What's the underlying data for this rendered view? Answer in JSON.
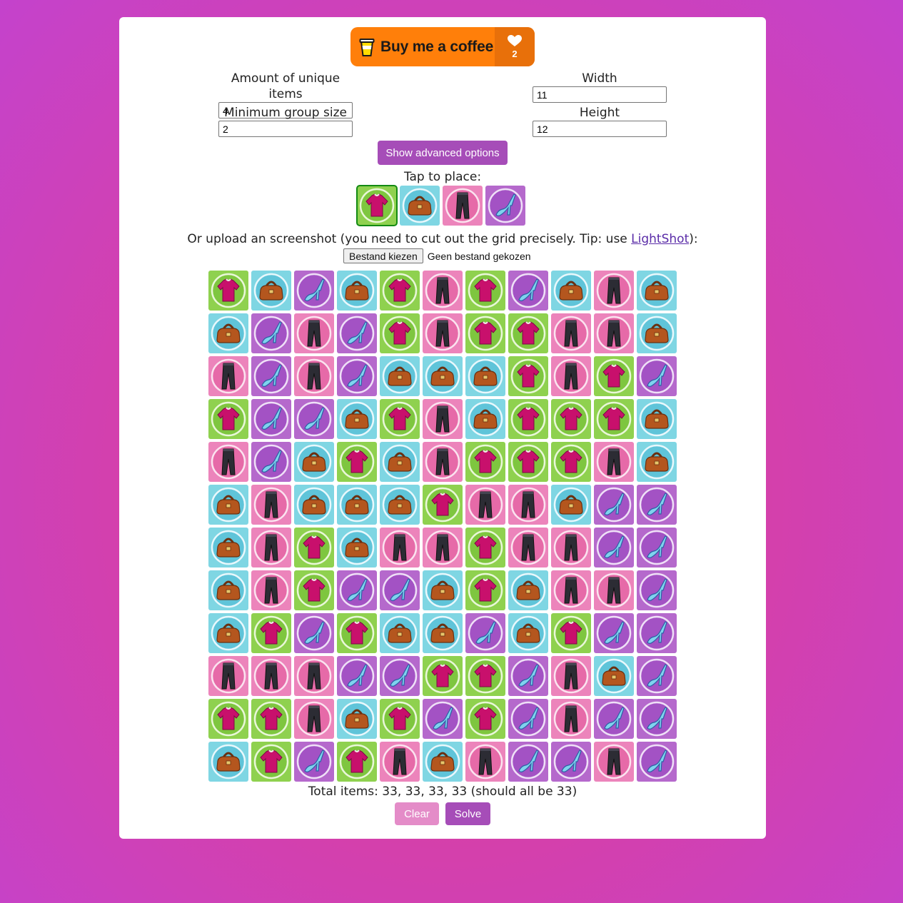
{
  "coffee": {
    "label": "Buy me a coffee",
    "count": "2"
  },
  "fields": {
    "unique_items": {
      "label": "Amount of unique items",
      "value": "4"
    },
    "width": {
      "label": "Width",
      "value": "11"
    },
    "min_group": {
      "label": "Minimum group size",
      "value": "2"
    },
    "height": {
      "label": "Height",
      "value": "12"
    }
  },
  "advanced_button": "Show advanced options",
  "tap_label": "Tap to place:",
  "palette": [
    "shirt",
    "bag",
    "pants",
    "heel"
  ],
  "palette_selected": "shirt",
  "upload": {
    "text_before": "Or upload an screenshot (you need to cut out the grid precisely. Tip: use ",
    "link": "LightShot",
    "text_after": "):",
    "file_button": "Bestand kiezen",
    "file_status": "Geen bestand gekozen"
  },
  "grid": [
    [
      "shirt",
      "bag",
      "heel",
      "bag",
      "shirt",
      "pants",
      "shirt",
      "heel",
      "bag",
      "pants",
      "bag"
    ],
    [
      "bag",
      "heel",
      "pants",
      "heel",
      "shirt",
      "pants",
      "shirt",
      "shirt",
      "pants",
      "pants",
      "bag"
    ],
    [
      "pants",
      "heel",
      "pants",
      "heel",
      "bag",
      "bag",
      "bag",
      "shirt",
      "pants",
      "shirt",
      "heel"
    ],
    [
      "shirt",
      "heel",
      "heel",
      "bag",
      "shirt",
      "pants",
      "bag",
      "shirt",
      "shirt",
      "shirt",
      "bag"
    ],
    [
      "pants",
      "heel",
      "bag",
      "shirt",
      "bag",
      "pants",
      "shirt",
      "shirt",
      "shirt",
      "pants",
      "bag"
    ],
    [
      "bag",
      "pants",
      "bag",
      "bag",
      "bag",
      "shirt",
      "pants",
      "pants",
      "bag",
      "heel",
      "heel"
    ],
    [
      "bag",
      "pants",
      "shirt",
      "bag",
      "pants",
      "pants",
      "shirt",
      "pants",
      "pants",
      "heel",
      "heel"
    ],
    [
      "bag",
      "pants",
      "shirt",
      "heel",
      "heel",
      "bag",
      "shirt",
      "bag",
      "pants",
      "pants",
      "heel"
    ],
    [
      "bag",
      "shirt",
      "heel",
      "shirt",
      "bag",
      "bag",
      "heel",
      "bag",
      "shirt",
      "heel",
      "heel"
    ],
    [
      "pants",
      "pants",
      "pants",
      "heel",
      "heel",
      "shirt",
      "shirt",
      "heel",
      "pants",
      "bag",
      "heel"
    ],
    [
      "shirt",
      "shirt",
      "pants",
      "bag",
      "shirt",
      "heel",
      "shirt",
      "heel",
      "pants",
      "heel",
      "heel"
    ],
    [
      "bag",
      "shirt",
      "heel",
      "shirt",
      "pants",
      "bag",
      "pants",
      "heel",
      "heel",
      "pants",
      "heel"
    ]
  ],
  "total_text": "Total items: 33, 33, 33, 33 (should all be 33)",
  "buttons": {
    "clear": "Clear",
    "solve": "Solve"
  },
  "colors": {
    "shirt_tile": "#8fd14f",
    "bag_tile": "#7fd6e3",
    "pants_tile": "#ec84bb",
    "heel_tile": "#b569cc",
    "button_primary": "#a64db8",
    "button_disabled": "#e48cc8",
    "coffee_orange": "#ff7f0a"
  }
}
